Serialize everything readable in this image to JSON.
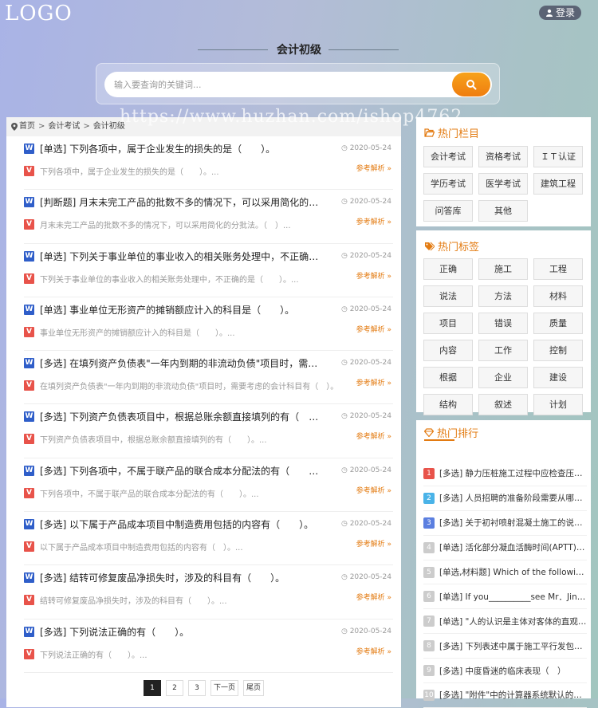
{
  "header": {
    "logo": "LOGO",
    "login_label": "登录",
    "title": "会计初级"
  },
  "search": {
    "placeholder": "输入要查询的关键词..."
  },
  "watermark": "https://www.huzhan.com/ishop4762",
  "breadcrumb": [
    "首页",
    "会计考试",
    "会计初级"
  ],
  "question_badge": "W",
  "summary_badge": "V",
  "answer_link": "参考解析 »",
  "questions": [
    {
      "title": "[单选] 下列各项中，属于企业发生的损失的是（　　）。",
      "summary": "下列各项中，属于企业发生的损失的是（　　）。...",
      "date": "2020-05-24"
    },
    {
      "title": "[判断题] 月末未完工产品的批数不多的情况下，可以采用简化的分批法。",
      "summary": "月末未完工产品的批数不多的情况下，可以采用简化的分批法。（　）...",
      "date": "2020-05-24"
    },
    {
      "title": "[单选] 下列关于事业单位的事业收入的相关账务处理中，不正确的是（　　）。",
      "summary": "下列关于事业单位的事业收入的相关账务处理中，不正确的是（　　）。...",
      "date": "2020-05-24"
    },
    {
      "title": "[单选] 事业单位无形资产的摊销额应计入的科目是（　　）。",
      "summary": "事业单位无形资产的摊销额应计入的科目是（　　）。...",
      "date": "2020-05-24"
    },
    {
      "title": "[多选] 在填列资产负债表\"一年内到期的非流动负债\"项目时，需要考虑的会计科目有（　）。",
      "summary": "在填列资产负债表\"一年内到期的非流动负债\"项目时，需要考虑的会计科目有（　）。...",
      "date": "2020-05-24"
    },
    {
      "title": "[多选] 下列资产负债表项目中，根据总账余额直接填列的有（　　）。",
      "summary": "下列资产负债表项目中，根据总账余额直接填列的有（　　）。...",
      "date": "2020-05-24"
    },
    {
      "title": "[多选] 下列各项中，不属于联产品的联合成本分配法的有（　　）。",
      "summary": "下列各项中，不属于联产品的联合成本分配法的有（　　）。...",
      "date": "2020-05-24"
    },
    {
      "title": "[多选] 以下属于产品成本项目中制造费用包括的内容有（　　）。",
      "summary": "以下属于产品成本项目中制造费用包括的内容有（　）。...",
      "date": "2020-05-24"
    },
    {
      "title": "[多选] 结转可修复废品净损失时，涉及的科目有（　　）。",
      "summary": "结转可修复废品净损失时，涉及的科目有（　　）。...",
      "date": "2020-05-24"
    },
    {
      "title": "[多选] 下列说法正确的有（　　）。",
      "summary": "下列说法正确的有（　　）。...",
      "date": "2020-05-24"
    }
  ],
  "pagination": [
    "1",
    "2",
    "3",
    "下一页",
    "尾页"
  ],
  "hot_columns": {
    "title": "热门栏目",
    "items": [
      "会计考试",
      "资格考试",
      "ＩＴ认证",
      "学历考试",
      "医学考试",
      "建筑工程",
      "问答库",
      "其他"
    ]
  },
  "hot_tags": {
    "title": "热门标签",
    "items": [
      "正确",
      "施工",
      "工程",
      "说法",
      "方法",
      "材料",
      "项目",
      "错误",
      "质量",
      "内容",
      "工作",
      "控制",
      "根据",
      "企业",
      "建设",
      "结构",
      "叙述",
      "计划"
    ]
  },
  "hot_rank": {
    "title": "热门排行",
    "items": [
      {
        "num": "1",
        "text": "[多选] 静力压桩施工过程中应检查压力、桩垂直度…",
        "color": "#e8534a"
      },
      {
        "num": "2",
        "text": "[多选] 人员招聘的准备阶段需要从哪些方面着手…",
        "color": "#4ab3e8"
      },
      {
        "num": "3",
        "text": "[多选] 关于初衬喷射混凝土施工的说法…",
        "color": "#5b7fe0"
      },
      {
        "num": "4",
        "text": "[单选] 活化部分凝血活酶时间(APTT)…",
        "color": "#cccccc"
      },
      {
        "num": "5",
        "text": "[单选,材料题] Which of the following…",
        "color": "#cccccc"
      },
      {
        "num": "6",
        "text": "[单选] If you__________see Mr．Jingle…",
        "color": "#cccccc"
      },
      {
        "num": "7",
        "text": "[单选] \"人的认识是主体对客体的直观反映\"…",
        "color": "#cccccc"
      },
      {
        "num": "8",
        "text": "[多选] 下列表述中属于施工平行发包模式…",
        "color": "#cccccc"
      },
      {
        "num": "9",
        "text": "[多选] 中度昏迷的临床表现（　）",
        "color": "#cccccc"
      },
      {
        "num": "10",
        "text": "[多选] \"附件\"中的计算器系统默认的是…",
        "color": "#cccccc"
      }
    ]
  },
  "colors": {
    "accent": "#e37b12",
    "search_button": "#ef7d0f",
    "question_badge": "#2f5ec9",
    "summary_badge": "#e8534a"
  }
}
